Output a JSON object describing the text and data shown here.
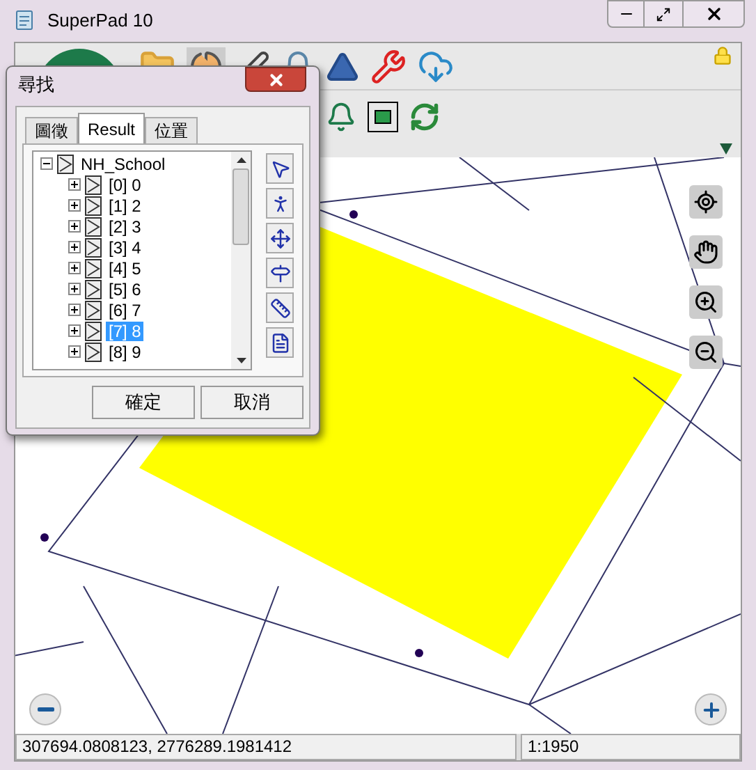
{
  "window": {
    "title": "SuperPad 10"
  },
  "dialog": {
    "title": "尋找",
    "tabs": [
      {
        "label": "圖徵",
        "selected": false
      },
      {
        "label": "Result",
        "selected": true
      },
      {
        "label": "位置",
        "selected": false
      }
    ],
    "tree": {
      "label": "NH_School",
      "expanded": true,
      "children": [
        {
          "label": "[0] 0",
          "expanded": false,
          "selected": false
        },
        {
          "label": "[1] 2",
          "expanded": false,
          "selected": false
        },
        {
          "label": "[2] 3",
          "expanded": false,
          "selected": false
        },
        {
          "label": "[3] 4",
          "expanded": false,
          "selected": false
        },
        {
          "label": "[4] 5",
          "expanded": false,
          "selected": false
        },
        {
          "label": "[5] 6",
          "expanded": false,
          "selected": false
        },
        {
          "label": "[6] 7",
          "expanded": false,
          "selected": false
        },
        {
          "label": "[7] 8",
          "expanded": false,
          "selected": true
        },
        {
          "label": "[8] 9",
          "expanded": false,
          "selected": false
        }
      ]
    },
    "buttons": [
      "確定",
      "取消"
    ]
  },
  "status_bar": {
    "coordinates": "307694.0808123, 2776289.1981412",
    "scale": "1:1950"
  }
}
